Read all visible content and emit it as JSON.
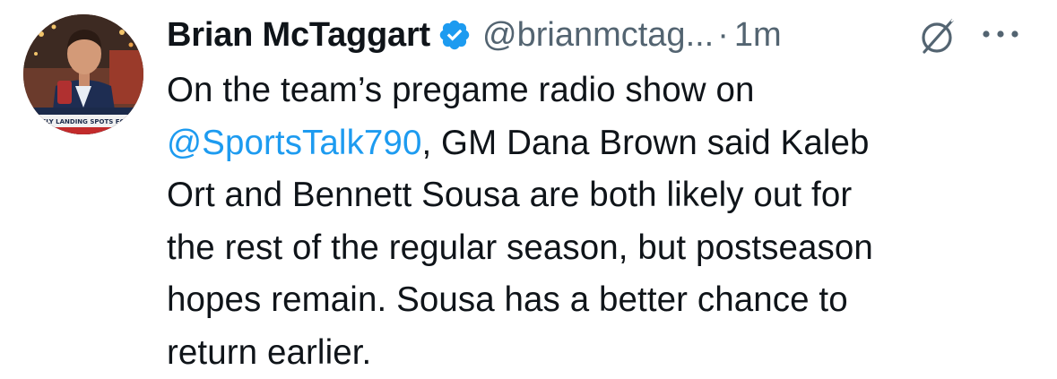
{
  "tweet": {
    "author": {
      "display_name": "Brian McTaggart",
      "handle": "@brianmctag...",
      "verified_icon": "verified-badge-icon",
      "avatar_caption": "LIKELY LANDING SPOTS FOR KY"
    },
    "separator": "·",
    "time": "1m",
    "grok_icon": "grok-icon",
    "more_icon": "more-horizontal-icon",
    "body": {
      "line1": "On the team’s pregame radio show on",
      "mention": "@SportsTalk790",
      "line2_rest": ", GM Dana Brown said Kaleb",
      "line3": "Ort and Bennett Sousa are both likely out for",
      "line4": "the rest of the regular season, but postseason",
      "line5": "hopes remain. Sousa has a better chance to",
      "line6": "return earlier."
    }
  },
  "colors": {
    "text_primary": "#0f1419",
    "text_secondary": "#536471",
    "link": "#1d9bf0",
    "verified": "#1d9bf0"
  }
}
